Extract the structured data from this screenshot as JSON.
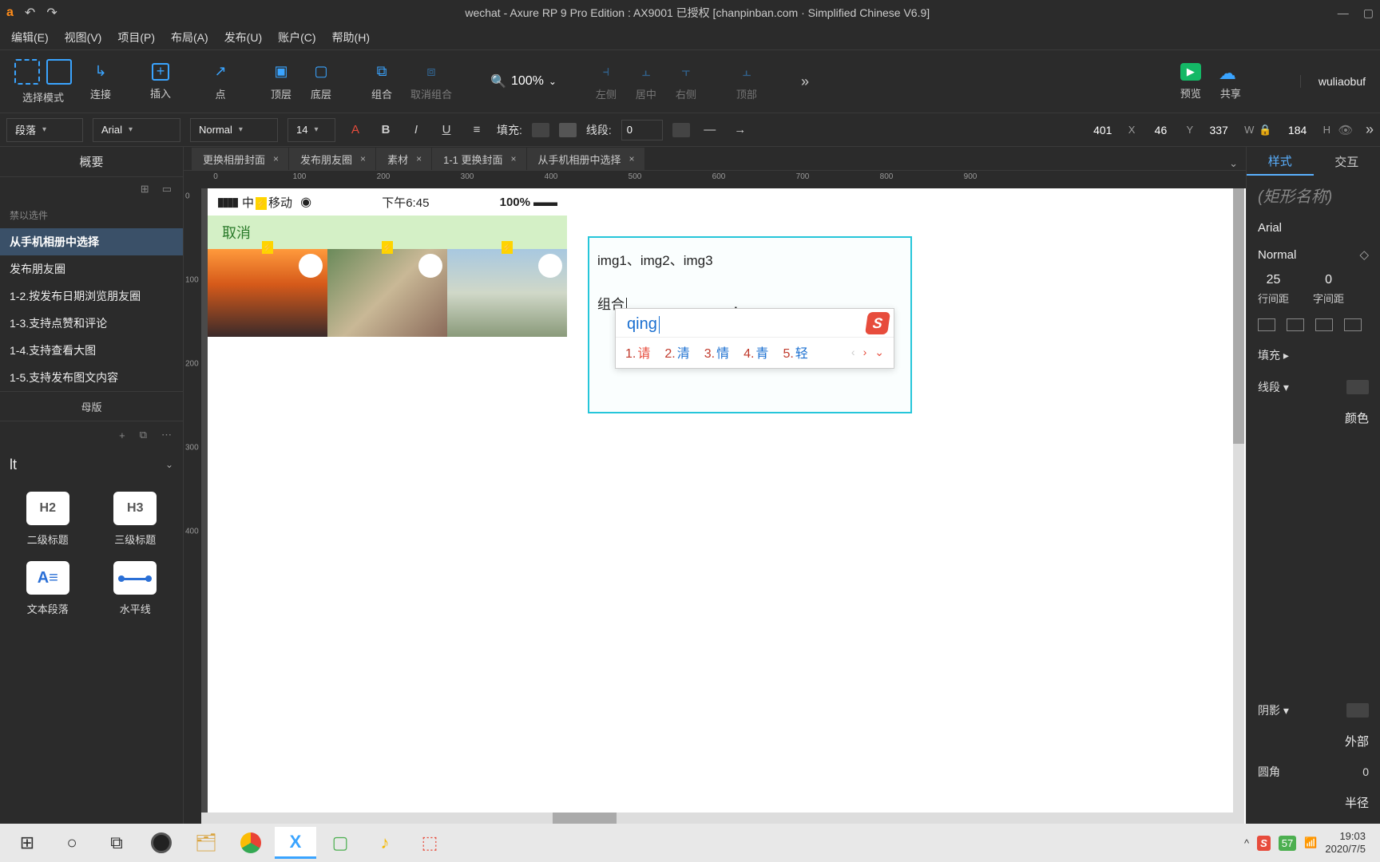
{
  "title": "wechat - Axure RP 9 Pro Edition : AX9001 已授权    [chanpinban.com · Simplified Chinese V6.9]",
  "menus": [
    "编辑(E)",
    "视图(V)",
    "项目(P)",
    "布局(A)",
    "发布(U)",
    "账户(C)",
    "帮助(H)"
  ],
  "toolbar": {
    "select_mode": "选择模式",
    "connect": "连接",
    "insert": "插入",
    "point": "点",
    "front": "顶层",
    "back": "底层",
    "group": "组合",
    "ungroup": "取消组合",
    "align_left": "左侧",
    "align_center": "居中",
    "align_right": "右侧",
    "align_top": "顶部",
    "zoom": "100%",
    "preview": "预览",
    "share": "共享",
    "more": "»",
    "user": "wuliaobuf"
  },
  "fmt": {
    "style": "段落",
    "font": "Arial",
    "weight": "Normal",
    "size": "14",
    "fill_label": "填充:",
    "stroke_label": "线段:",
    "stroke_val": "0",
    "x": "401",
    "y": "46",
    "w": "337",
    "h": "184",
    "more": "»"
  },
  "tabs": [
    "更换相册封面",
    "发布朋友圈",
    "素材",
    "1-1 更换封面",
    "从手机相册中选择"
  ],
  "left": {
    "header": "概要",
    "items": [
      {
        "t": "禁以选件",
        "dim": true
      },
      {
        "t": "从手机相册中选择",
        "sel": true
      },
      {
        "t": "发布朋友圈"
      },
      {
        "t": "1-2.按发布日期浏览朋友圈"
      },
      {
        "t": "1-3.支持点赞和评论"
      },
      {
        "t": "1-4.支持查看大图"
      },
      {
        "t": "1-5.支持发布图文内容"
      }
    ],
    "masters": "母版",
    "lib_name": "lt",
    "widgets": [
      {
        "label": "二级标题",
        "code": "H2"
      },
      {
        "label": "三级标题",
        "code": "H3"
      },
      {
        "label": "文本段落",
        "code": "para"
      },
      {
        "label": "水平线",
        "code": "hr"
      }
    ]
  },
  "ruler_h": [
    0,
    100,
    200,
    300,
    400,
    500,
    600,
    700,
    800,
    900
  ],
  "ruler_v": [
    0,
    100,
    200,
    300,
    400
  ],
  "phone": {
    "carrier": "中国移动",
    "time": "下午6:45",
    "battery": "100%",
    "cancel": "取消"
  },
  "note": {
    "line1": "img1、img2、img3",
    "line2": "组合"
  },
  "ime": {
    "typed": "qing",
    "cands": [
      {
        "n": "1.",
        "t": "请"
      },
      {
        "n": "2.",
        "t": "清"
      },
      {
        "n": "3.",
        "t": "情"
      },
      {
        "n": "4.",
        "t": "青"
      },
      {
        "n": "5.",
        "t": "轻"
      }
    ]
  },
  "right": {
    "tab_style": "样式",
    "tab_interact": "交互",
    "shape_name": "(矩形名称)",
    "font": "Arial",
    "weight": "Normal",
    "line_h_v": "25",
    "line_h_l": "行间距",
    "letter_v": "0",
    "letter_l": "字间距",
    "fill": "填充 ▸",
    "stroke": "线段 ▾",
    "color": "颜色",
    "shadow": "阴影 ▾",
    "outer": "外部",
    "radius": "圆角",
    "radius_v": "0",
    "radius_l": "半径"
  },
  "taskbar": {
    "time": "19:03",
    "date": "2020/7/5"
  }
}
